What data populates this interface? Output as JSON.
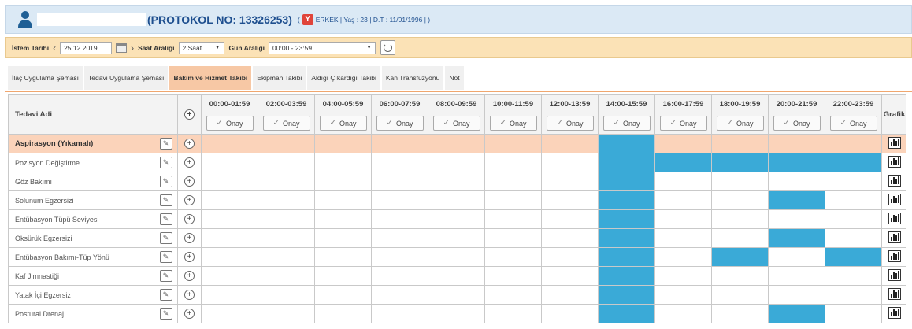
{
  "header": {
    "protocol_text": "(PROTOKOL NO: 13326253)",
    "paren_open": "(",
    "gender_badge": "Y",
    "patient_info": "ERKEK | Yaş : 23 | D.T : 11/01/1996 | )"
  },
  "filter": {
    "istem_label": "İstem Tarihi",
    "date_value": "25.12.2019",
    "saat_label": "Saat Aralığı",
    "saat_value": "2 Saat",
    "gun_label": "Gün Aralığı",
    "gun_value": "00:00 - 23:59"
  },
  "tabs": [
    {
      "label": "İlaç Uygulama Şeması",
      "active": false
    },
    {
      "label": "Tedavi Uygulama Şeması",
      "active": false
    },
    {
      "label": "Bakım ve Hizmet Takibi",
      "active": true
    },
    {
      "label": "Ekipman Takibi",
      "active": false
    },
    {
      "label": "Aldığı Çıkardığı Takibi",
      "active": false
    },
    {
      "label": "Kan Transfüzyonu",
      "active": false
    },
    {
      "label": "Not",
      "active": false
    }
  ],
  "table": {
    "name_header": "Tedavi Adi",
    "grafik_header": "Grafik",
    "onay_label": "Onay",
    "slots": [
      "00:00-01:59",
      "02:00-03:59",
      "04:00-05:59",
      "06:00-07:59",
      "08:00-09:59",
      "10:00-11:59",
      "12:00-13:59",
      "14:00-15:59",
      "16:00-17:59",
      "18:00-19:59",
      "20:00-21:59",
      "22:00-23:59"
    ],
    "rows": [
      {
        "name": "Aspirasyon (Yıkamalı)",
        "highlight": true,
        "filled": [
          7
        ]
      },
      {
        "name": "Pozisyon Değiştirme",
        "highlight": false,
        "filled": [
          7,
          8,
          9,
          10,
          11
        ]
      },
      {
        "name": "Göz Bakımı",
        "highlight": false,
        "filled": [
          7
        ]
      },
      {
        "name": "Solunum Egzersizi",
        "highlight": false,
        "filled": [
          7,
          10
        ]
      },
      {
        "name": "Entübasyon Tüpü Seviyesi",
        "highlight": false,
        "filled": [
          7
        ]
      },
      {
        "name": "Öksürük Egzersizi",
        "highlight": false,
        "filled": [
          7,
          10
        ]
      },
      {
        "name": "Entübasyon Bakımı-Tüp Yönü",
        "highlight": false,
        "filled": [
          7,
          9,
          11
        ]
      },
      {
        "name": "Kaf Jimnastiği",
        "highlight": false,
        "filled": [
          7
        ]
      },
      {
        "name": "Yatak İçi Egzersiz",
        "highlight": false,
        "filled": [
          7
        ]
      },
      {
        "name": "Postural Drenaj",
        "highlight": false,
        "filled": [
          7,
          10
        ]
      }
    ]
  },
  "colors": {
    "filled_cell": "#3aaad7",
    "highlight_row": "#fbd3ba",
    "active_tab": "#f7c8a5",
    "header_bg": "#dbe9f5",
    "filter_bg": "#fbe2b6",
    "gender_badge": "#e0443a"
  }
}
